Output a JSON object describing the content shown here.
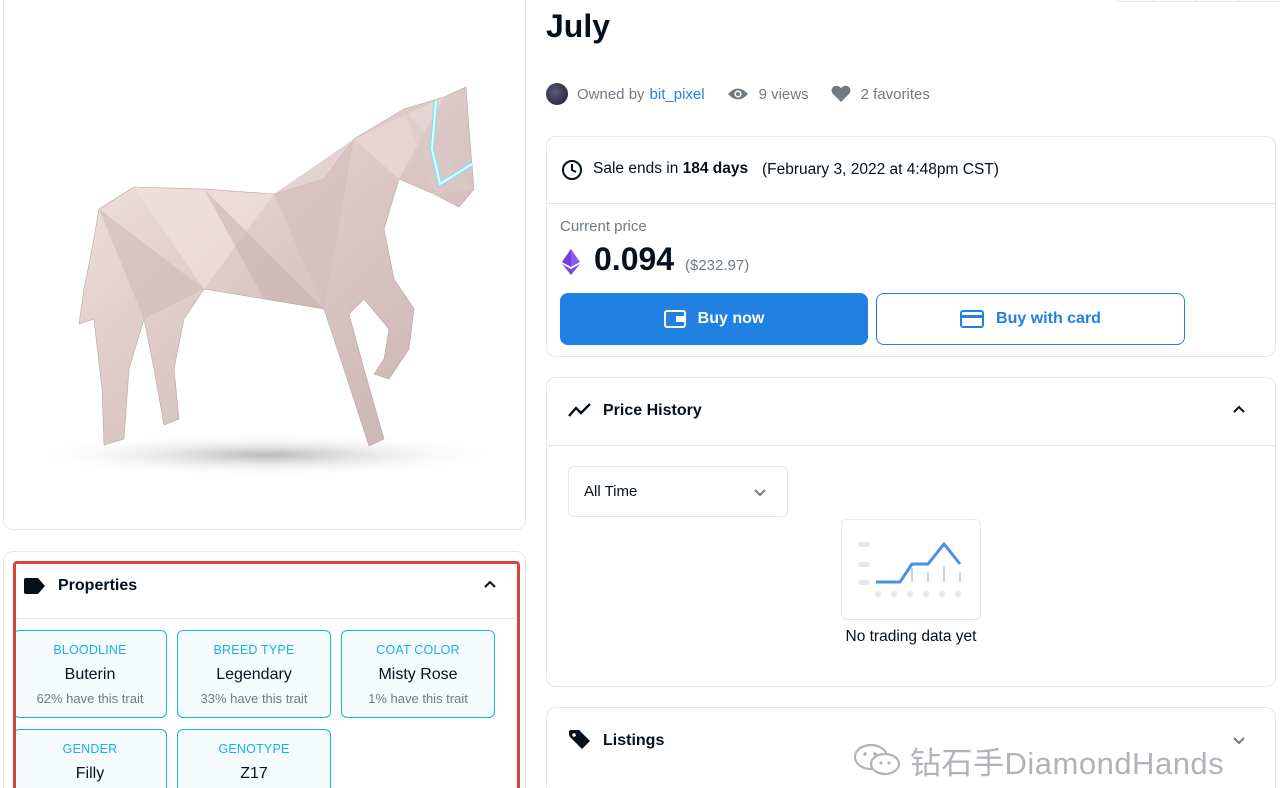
{
  "item": {
    "title": "July",
    "owner_prefix": "Owned by",
    "owner_name": "bit_pixel",
    "views": "9 views",
    "favorites": "2 favorites"
  },
  "sale": {
    "prefix": "Sale ends in",
    "days": "184 days",
    "date": "(February 3, 2022 at 4:48pm CST)",
    "price_label": "Current price",
    "price": "0.094",
    "price_usd": "($232.97)",
    "buy_now_label": "Buy now",
    "buy_card_label": "Buy with card"
  },
  "price_history": {
    "title": "Price History",
    "range_selected": "All Time",
    "empty_message": "No trading data yet"
  },
  "listings": {
    "title": "Listings"
  },
  "properties": {
    "title": "Properties",
    "items": [
      {
        "type": "BLOODLINE",
        "value": "Buterin",
        "rarity": "62% have this trait"
      },
      {
        "type": "BREED TYPE",
        "value": "Legendary",
        "rarity": "33% have this trait"
      },
      {
        "type": "COAT COLOR",
        "value": "Misty Rose",
        "rarity": "1% have this trait"
      },
      {
        "type": "GENDER",
        "value": "Filly",
        "rarity": ""
      },
      {
        "type": "GENOTYPE",
        "value": "Z17",
        "rarity": ""
      }
    ]
  },
  "watermark": {
    "text": "钻石手DiamondHands"
  },
  "icons": {
    "views": "eye-icon",
    "favorites": "heart-icon",
    "sale": "clock-icon",
    "currency": "ethereum-icon",
    "buy_now": "wallet-icon",
    "buy_card": "credit-card-icon",
    "price_history": "trending-icon",
    "listings": "tag-icon",
    "properties": "tag-icon"
  },
  "colors": {
    "accent": "#2081e2",
    "trait_accent": "#15b2e5",
    "highlight_border": "#d94535"
  }
}
